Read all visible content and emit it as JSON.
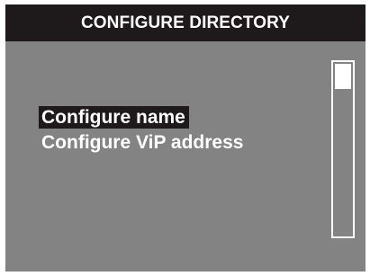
{
  "header": {
    "title": "CONFIGURE DIRECTORY"
  },
  "menu": {
    "items": [
      {
        "label": "Configure name",
        "selected": true
      },
      {
        "label": "Configure ViP address",
        "selected": false
      }
    ]
  },
  "scrollbar": {
    "position": 0
  },
  "colors": {
    "screen_background": "#838383",
    "title_bar": "#1e1a1b",
    "selection": "#1e1a1b",
    "text": "#ffffff"
  }
}
